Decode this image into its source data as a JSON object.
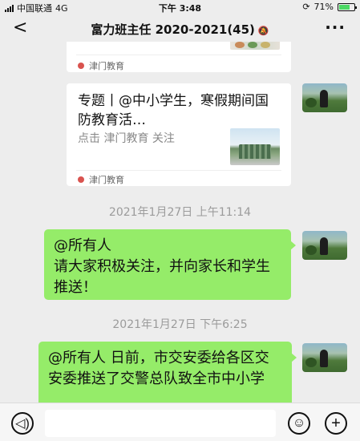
{
  "status_bar": {
    "carrier": "中国联通",
    "network": "4G",
    "time": "下午 3:48",
    "battery": "71%"
  },
  "nav": {
    "back_icon": "<",
    "title": "富力班主任 2020-2021(45)",
    "more_icon": "···"
  },
  "top_card": {
    "source": "津门教育"
  },
  "article_card": {
    "title": "专题丨@中小学生，寒假期间国防教育活…",
    "desc": "点击 津门教育 关注",
    "source": "津门教育"
  },
  "messages": [
    {
      "time": "2021年1月27日 上午11:14",
      "text": "@所有人\n请大家积极关注，并向家长和学生推送！"
    },
    {
      "time": "2021年1月27日 下午6:25",
      "text": "@所有人 日前，市交安委给各区交安委推送了交警总队致全市中小学"
    }
  ],
  "colors": {
    "background": "#ededed",
    "bubble": "#95ec69",
    "card": "#ffffff"
  },
  "icons": {
    "back": "chevron-left-icon",
    "more": "more-dots-icon",
    "mute": "bell-off-icon",
    "voice": "voice-icon",
    "emoji": "emoji-icon",
    "add": "plus-icon"
  }
}
